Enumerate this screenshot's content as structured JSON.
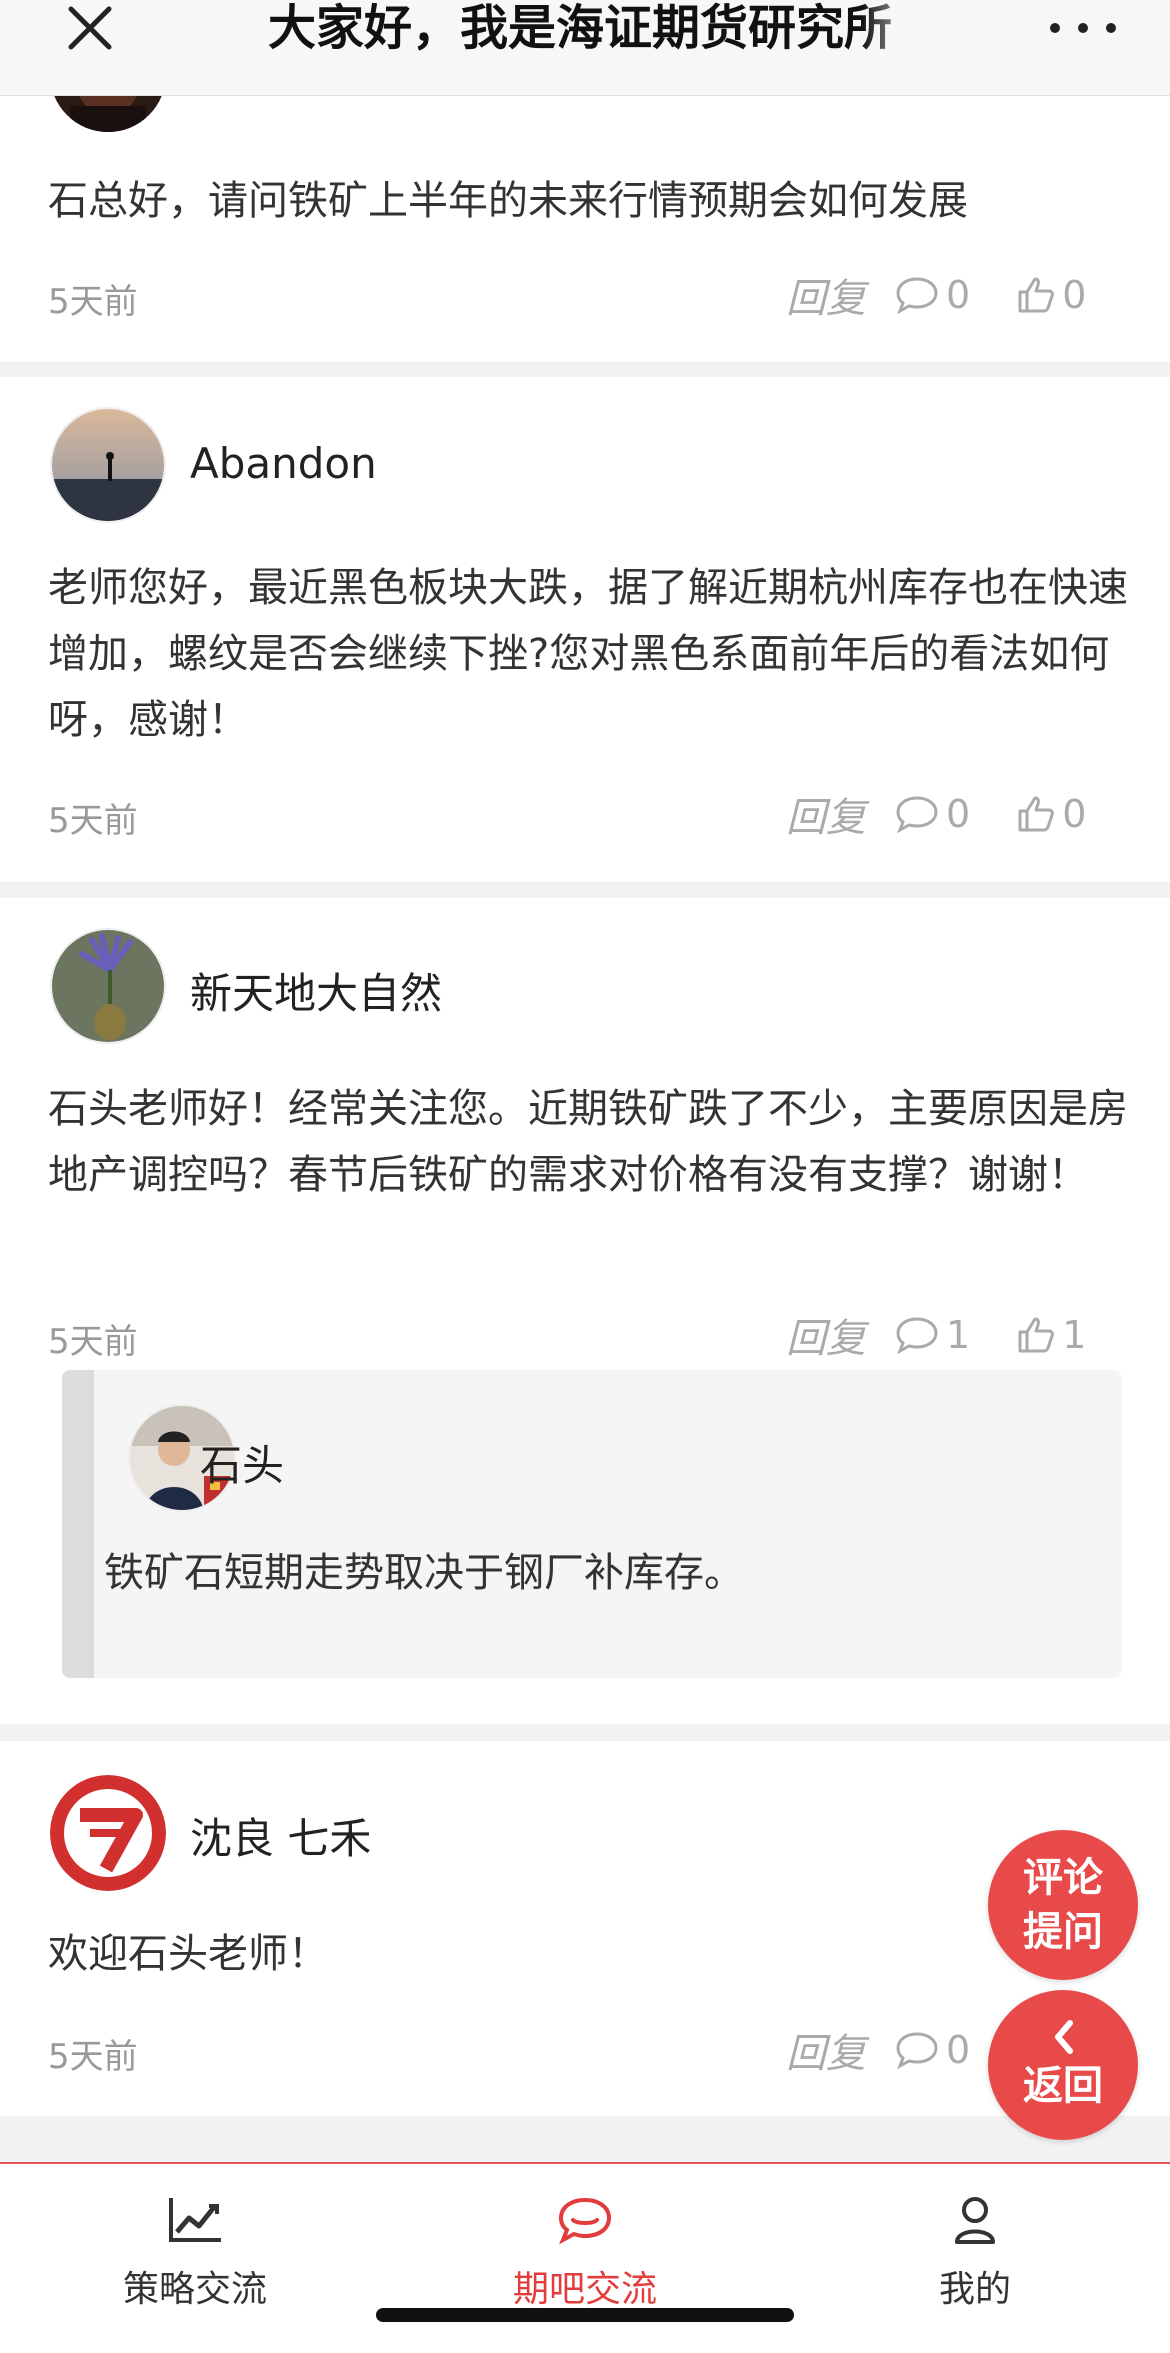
{
  "header": {
    "title": "大家好，我是海证期货研究所"
  },
  "comments": [
    {
      "content": "石总好，请问铁矿上半年的未来行情预期会如何发展",
      "time": "5天前",
      "reply_label": "回复",
      "comment_count": "0",
      "like_count": "0"
    },
    {
      "username": "Abandon",
      "content": "老师您好，最近黑色板块大跌，据了解近期杭州库存也在快速增加，螺纹是否会继续下挫?您对黑色系面前年后的看法如何呀，感谢！",
      "time": "5天前",
      "reply_label": "回复",
      "comment_count": "0",
      "like_count": "0"
    },
    {
      "username": "新天地大自然",
      "content": "石头老师好！经常关注您。近期铁矿跌了不少，主要原因是房地产调控吗？春节后铁矿的需求对价格有没有支撑？谢谢！",
      "time": "5天前",
      "reply_label": "回复",
      "comment_count": "1",
      "like_count": "1",
      "reply": {
        "username": "石头",
        "content": "铁矿石短期走势取决于钢厂补库存。"
      }
    },
    {
      "username": "沈良 七禾",
      "content": "欢迎石头老师！",
      "time": "5天前",
      "reply_label": "回复",
      "comment_count": "0"
    }
  ],
  "fab": {
    "comment_line1": "评论",
    "comment_line2": "提问",
    "back_label": "返回"
  },
  "bottom_nav": {
    "items": [
      {
        "label": "策略交流",
        "icon": "trend-chart-icon",
        "active": false
      },
      {
        "label": "期吧交流",
        "icon": "chat-bubble-icon",
        "active": true
      },
      {
        "label": "我的",
        "icon": "user-icon",
        "active": false
      }
    ]
  },
  "colors": {
    "accent": "#e23c3c",
    "fab": "#e84a4a",
    "muted": "#aaaaaa"
  }
}
